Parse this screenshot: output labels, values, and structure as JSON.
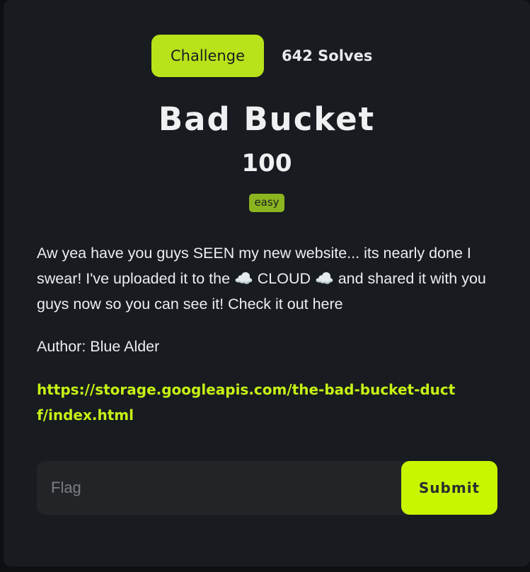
{
  "tabs": {
    "challenge_label": "Challenge",
    "solves_label": "642 Solves"
  },
  "challenge": {
    "title": "Bad Bucket",
    "points": "100",
    "difficulty": "easy",
    "description": "Aw yea have you guys SEEN my new website... its nearly done I swear! I've uploaded it to the ☁️ CLOUD ☁️ and shared it with you guys now so you can see it! Check it out here",
    "author": "Author: Blue Alder",
    "link": "https://storage.googleapis.com/the-bad-bucket-ductf/index.html"
  },
  "form": {
    "flag_placeholder": "Flag",
    "flag_value": "",
    "submit_label": "Submit"
  },
  "colors": {
    "accent": "#c8f500",
    "tab_active": "#b8e21a",
    "badge_easy": "#8cb51f",
    "panel_bg": "#181b20",
    "link": "#c7f016"
  }
}
